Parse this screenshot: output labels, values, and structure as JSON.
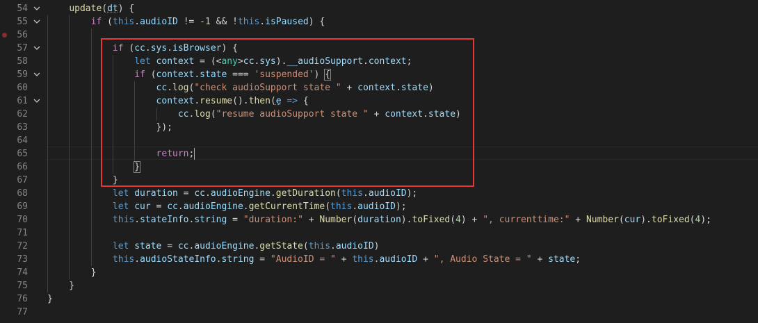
{
  "editor": {
    "breakpoint_line": "56",
    "lines": [
      {
        "num": "54",
        "fold": true,
        "tokens": [
          [
            "p",
            "    "
          ],
          [
            "f",
            "update"
          ],
          [
            "p",
            "("
          ],
          [
            "v u",
            "dt"
          ],
          [
            "p",
            ") {"
          ]
        ]
      },
      {
        "num": "55",
        "fold": true,
        "tokens": [
          [
            "p",
            "        "
          ],
          [
            "c",
            "if"
          ],
          [
            "p",
            " ("
          ],
          [
            "k",
            "this"
          ],
          [
            "p",
            "."
          ],
          [
            "v",
            "audioID"
          ],
          [
            "p",
            " != -"
          ],
          [
            "n",
            "1"
          ],
          [
            "p",
            " && !"
          ],
          [
            "k",
            "this"
          ],
          [
            "p",
            "."
          ],
          [
            "v",
            "isPaused"
          ],
          [
            "p",
            ") {"
          ]
        ]
      },
      {
        "num": "56",
        "fold": false,
        "tokens": []
      },
      {
        "num": "57",
        "fold": true,
        "tokens": [
          [
            "p",
            "            "
          ],
          [
            "c",
            "if"
          ],
          [
            "p",
            " ("
          ],
          [
            "v",
            "cc"
          ],
          [
            "p",
            "."
          ],
          [
            "v",
            "sys"
          ],
          [
            "p",
            "."
          ],
          [
            "v",
            "isBrowser"
          ],
          [
            "p",
            ") {"
          ]
        ]
      },
      {
        "num": "58",
        "fold": false,
        "tokens": [
          [
            "p",
            "                "
          ],
          [
            "k",
            "let"
          ],
          [
            "p",
            " "
          ],
          [
            "v",
            "context"
          ],
          [
            "p",
            " = (<"
          ],
          [
            "t",
            "any"
          ],
          [
            "p",
            ">"
          ],
          [
            "v",
            "cc"
          ],
          [
            "p",
            "."
          ],
          [
            "v",
            "sys"
          ],
          [
            "p",
            ")."
          ],
          [
            "v",
            "__audioSupport"
          ],
          [
            "p",
            "."
          ],
          [
            "v",
            "context"
          ],
          [
            "p",
            ";"
          ]
        ]
      },
      {
        "num": "59",
        "fold": true,
        "tokens": [
          [
            "p",
            "                "
          ],
          [
            "c",
            "if"
          ],
          [
            "p",
            " ("
          ],
          [
            "v",
            "context"
          ],
          [
            "p",
            "."
          ],
          [
            "v",
            "state"
          ],
          [
            "p",
            " === "
          ],
          [
            "s",
            "'suspended'"
          ],
          [
            "p",
            ") "
          ],
          [
            "p br",
            "{"
          ]
        ]
      },
      {
        "num": "60",
        "fold": false,
        "tokens": [
          [
            "p",
            "                    "
          ],
          [
            "v",
            "cc"
          ],
          [
            "p",
            "."
          ],
          [
            "f",
            "log"
          ],
          [
            "p",
            "("
          ],
          [
            "s",
            "\"check audioSupport state \""
          ],
          [
            "p",
            " + "
          ],
          [
            "v",
            "context"
          ],
          [
            "p",
            "."
          ],
          [
            "v",
            "state"
          ],
          [
            "p",
            ")"
          ]
        ]
      },
      {
        "num": "61",
        "fold": true,
        "tokens": [
          [
            "p",
            "                    "
          ],
          [
            "v",
            "context"
          ],
          [
            "p",
            "."
          ],
          [
            "f",
            "resume"
          ],
          [
            "p",
            "()."
          ],
          [
            "f",
            "then"
          ],
          [
            "p",
            "("
          ],
          [
            "v u",
            "e"
          ],
          [
            "p",
            " "
          ],
          [
            "k",
            "=>"
          ],
          [
            "p",
            " {"
          ]
        ]
      },
      {
        "num": "62",
        "fold": false,
        "tokens": [
          [
            "p",
            "                        "
          ],
          [
            "v",
            "cc"
          ],
          [
            "p",
            "."
          ],
          [
            "f",
            "log"
          ],
          [
            "p",
            "("
          ],
          [
            "s",
            "\"resume audioSupport state \""
          ],
          [
            "p",
            " + "
          ],
          [
            "v",
            "context"
          ],
          [
            "p",
            "."
          ],
          [
            "v",
            "state"
          ],
          [
            "p",
            ")"
          ]
        ]
      },
      {
        "num": "63",
        "fold": false,
        "tokens": [
          [
            "p",
            "                    });"
          ]
        ]
      },
      {
        "num": "64",
        "fold": false,
        "tokens": []
      },
      {
        "num": "65",
        "fold": false,
        "tokens": [
          [
            "p",
            "                    "
          ],
          [
            "c",
            "return"
          ],
          [
            "p",
            ";"
          ]
        ]
      },
      {
        "num": "66",
        "fold": false,
        "tokens": [
          [
            "p",
            "                "
          ],
          [
            "p br",
            "}"
          ]
        ]
      },
      {
        "num": "67",
        "fold": false,
        "tokens": [
          [
            "p",
            "            }"
          ]
        ]
      },
      {
        "num": "68",
        "fold": false,
        "tokens": [
          [
            "p",
            "            "
          ],
          [
            "k",
            "let"
          ],
          [
            "p",
            " "
          ],
          [
            "v",
            "duration"
          ],
          [
            "p",
            " = "
          ],
          [
            "v",
            "cc"
          ],
          [
            "p",
            "."
          ],
          [
            "v",
            "audioEngine"
          ],
          [
            "p",
            "."
          ],
          [
            "f",
            "getDuration"
          ],
          [
            "p",
            "("
          ],
          [
            "k",
            "this"
          ],
          [
            "p",
            "."
          ],
          [
            "v",
            "audioID"
          ],
          [
            "p",
            ");"
          ]
        ]
      },
      {
        "num": "69",
        "fold": false,
        "tokens": [
          [
            "p",
            "            "
          ],
          [
            "k",
            "let"
          ],
          [
            "p",
            " "
          ],
          [
            "v",
            "cur"
          ],
          [
            "p",
            " = "
          ],
          [
            "v",
            "cc"
          ],
          [
            "p",
            "."
          ],
          [
            "v",
            "audioEngine"
          ],
          [
            "p",
            "."
          ],
          [
            "f",
            "getCurrentTime"
          ],
          [
            "p",
            "("
          ],
          [
            "k",
            "this"
          ],
          [
            "p",
            "."
          ],
          [
            "v",
            "audioID"
          ],
          [
            "p",
            ");"
          ]
        ]
      },
      {
        "num": "70",
        "fold": false,
        "tokens": [
          [
            "p",
            "            "
          ],
          [
            "k",
            "this"
          ],
          [
            "p",
            "."
          ],
          [
            "v",
            "stateInfo"
          ],
          [
            "p",
            "."
          ],
          [
            "v",
            "string"
          ],
          [
            "p",
            " = "
          ],
          [
            "s",
            "\"duration:\""
          ],
          [
            "p",
            " + "
          ],
          [
            "f",
            "Number"
          ],
          [
            "p",
            "("
          ],
          [
            "v",
            "duration"
          ],
          [
            "p",
            ")."
          ],
          [
            "f",
            "toFixed"
          ],
          [
            "p",
            "("
          ],
          [
            "n",
            "4"
          ],
          [
            "p",
            ") + "
          ],
          [
            "s",
            "\", currenttime:\""
          ],
          [
            "p",
            " + "
          ],
          [
            "f",
            "Number"
          ],
          [
            "p",
            "("
          ],
          [
            "v",
            "cur"
          ],
          [
            "p",
            ")."
          ],
          [
            "f",
            "toFixed"
          ],
          [
            "p",
            "("
          ],
          [
            "n",
            "4"
          ],
          [
            "p",
            ");"
          ]
        ]
      },
      {
        "num": "71",
        "fold": false,
        "tokens": []
      },
      {
        "num": "72",
        "fold": false,
        "tokens": [
          [
            "p",
            "            "
          ],
          [
            "k",
            "let"
          ],
          [
            "p",
            " "
          ],
          [
            "v",
            "state"
          ],
          [
            "p",
            " = "
          ],
          [
            "v",
            "cc"
          ],
          [
            "p",
            "."
          ],
          [
            "v",
            "audioEngine"
          ],
          [
            "p",
            "."
          ],
          [
            "f",
            "getState"
          ],
          [
            "p",
            "("
          ],
          [
            "k",
            "this"
          ],
          [
            "p",
            "."
          ],
          [
            "v",
            "audioID"
          ],
          [
            "p",
            ")"
          ]
        ]
      },
      {
        "num": "73",
        "fold": false,
        "tokens": [
          [
            "p",
            "            "
          ],
          [
            "k",
            "this"
          ],
          [
            "p",
            "."
          ],
          [
            "v",
            "audioStateInfo"
          ],
          [
            "p",
            "."
          ],
          [
            "v",
            "string"
          ],
          [
            "p",
            " = "
          ],
          [
            "s",
            "\"AudioID = \""
          ],
          [
            "p",
            " + "
          ],
          [
            "k",
            "this"
          ],
          [
            "p",
            "."
          ],
          [
            "v",
            "audioID"
          ],
          [
            "p",
            " + "
          ],
          [
            "s",
            "\", Audio State = \""
          ],
          [
            "p",
            " + "
          ],
          [
            "v",
            "state"
          ],
          [
            "p",
            ";"
          ]
        ]
      },
      {
        "num": "74",
        "fold": false,
        "tokens": [
          [
            "p",
            "        }"
          ]
        ]
      },
      {
        "num": "75",
        "fold": false,
        "tokens": [
          [
            "p",
            "    }"
          ]
        ]
      },
      {
        "num": "76",
        "fold": false,
        "tokens": [
          [
            "p",
            "}"
          ]
        ]
      },
      {
        "num": "77",
        "fold": false,
        "tokens": []
      }
    ]
  }
}
